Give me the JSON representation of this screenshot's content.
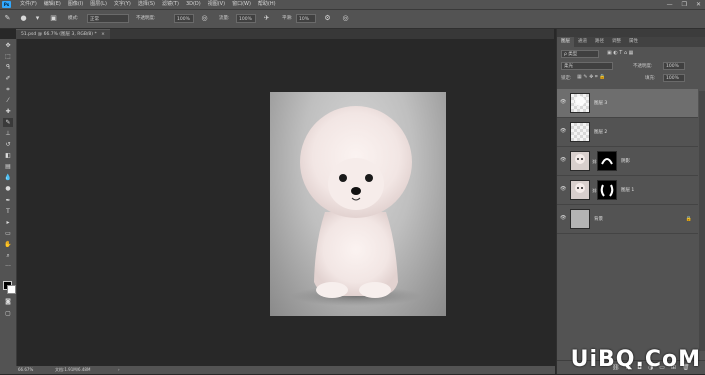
{
  "app": {
    "logo": "Ps"
  },
  "menu": [
    "文件(F)",
    "编辑(E)",
    "图像(I)",
    "图层(L)",
    "文字(Y)",
    "选择(S)",
    "滤镜(T)",
    "3D(D)",
    "视图(V)",
    "窗口(W)",
    "帮助(H)"
  ],
  "window_controls": [
    "—",
    "❐",
    "✕"
  ],
  "options": {
    "mode_label": "模式:",
    "mode_value": "正常",
    "opacity_label": "不透明度:",
    "opacity_value": "100%",
    "flow_label": "流量:",
    "flow_value": "100%",
    "smooth_label": "平滑:",
    "smooth_value": "10%"
  },
  "document": {
    "tab_title": "51.psd @ 66.7% (图层 3, RGB/8) *",
    "zoom": "66.67%",
    "doc_size": "文档:1.91M/6.48M"
  },
  "toolbar_icons": [
    "move-icon",
    "marquee-icon",
    "lasso-icon",
    "quick-select-icon",
    "crop-icon",
    "eyedropper-icon",
    "healing-icon",
    "brush-icon",
    "stamp-icon",
    "history-brush-icon",
    "eraser-icon",
    "gradient-icon",
    "blur-icon",
    "dodge-icon",
    "pen-icon",
    "type-icon",
    "path-select-icon",
    "shape-icon",
    "hand-icon",
    "zoom-icon",
    "more-icon"
  ],
  "layers_panel": {
    "tabs": [
      "图层",
      "通道",
      "路径",
      "调整",
      "属性"
    ],
    "filter_label": "ρ 类型",
    "blend_mode": "柔光",
    "opacity_label": "不透明度:",
    "opacity_value": "100%",
    "lock_label": "锁定:",
    "fill_label": "填充:",
    "fill_value": "100%",
    "layers": [
      {
        "name": "图层 3",
        "selected": true
      },
      {
        "name": "图层 2",
        "selected": false
      },
      {
        "name": "阴影",
        "selected": false
      },
      {
        "name": "图层 1",
        "selected": false
      },
      {
        "name": "背景",
        "selected": false
      }
    ],
    "footer_icons": [
      "link-icon",
      "fx-icon",
      "mask-icon",
      "adjustment-icon",
      "folder-icon",
      "new-layer-icon",
      "trash-icon"
    ]
  },
  "watermark": "UiBQ.CoM"
}
